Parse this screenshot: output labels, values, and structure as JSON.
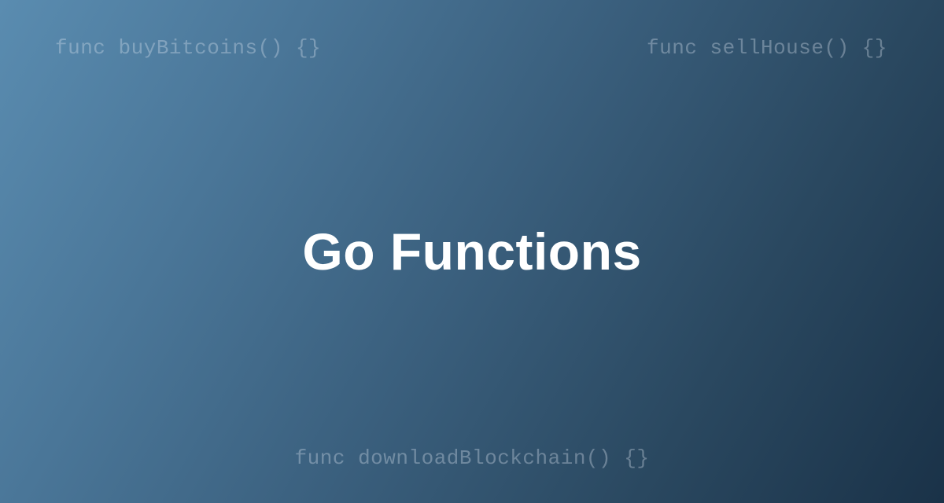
{
  "title": "Go Functions",
  "code_snippets": {
    "top_left": "func buyBitcoins() {}",
    "top_right": "func sellHouse() {}",
    "bottom": "func downloadBlockchain() {}"
  }
}
